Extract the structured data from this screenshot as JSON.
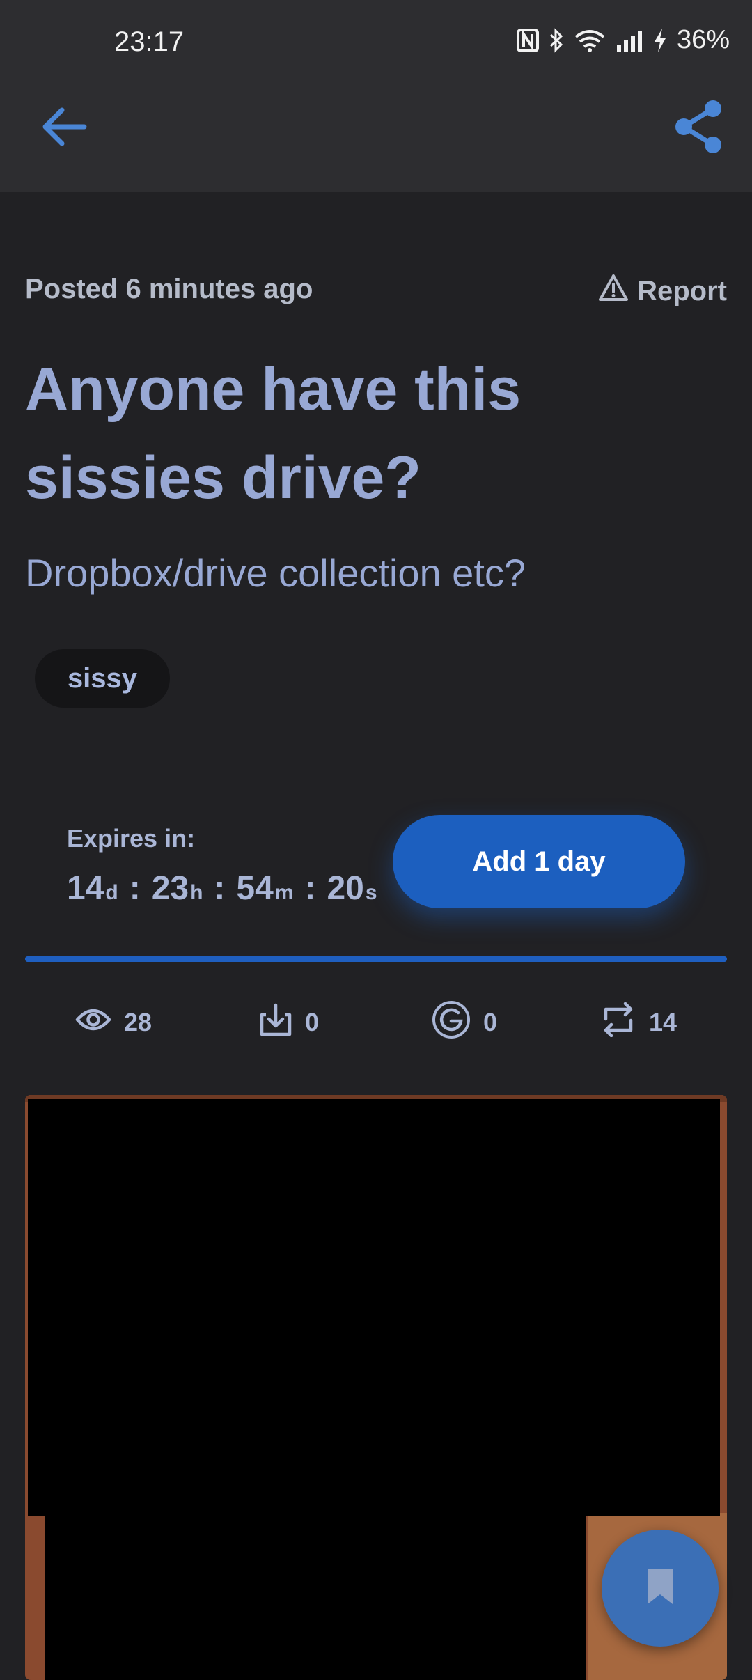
{
  "status_bar": {
    "time": "23:17",
    "battery": "36%",
    "icons": [
      "nfc-icon",
      "bluetooth-icon",
      "wifi-icon",
      "signal-icon",
      "charging-icon"
    ]
  },
  "app_bar": {
    "back_icon": "arrow-left-icon",
    "share_icon": "share-icon",
    "accent": "#4a86d6"
  },
  "post": {
    "posted": "Posted 6 minutes ago",
    "report_label": "Report",
    "title": "Anyone have this sissies drive?",
    "description": "Dropbox/drive collection etc?",
    "tags": [
      "sissy"
    ]
  },
  "expiry": {
    "label": "Expires in:",
    "days": "14",
    "days_unit": "d",
    "hours": "23",
    "hours_unit": "h",
    "minutes": "54",
    "minutes_unit": "m",
    "seconds": "20",
    "seconds_unit": "s",
    "separator": ":",
    "add_button": "Add 1 day",
    "progress_fraction": 1.0,
    "button_color": "#1c5fbf"
  },
  "stats": {
    "views": "28",
    "downloads": "0",
    "google": "0",
    "reposts": "14"
  },
  "colors": {
    "background": "#212124",
    "title": "#98a8d4",
    "fab": "#3b6fb6"
  }
}
